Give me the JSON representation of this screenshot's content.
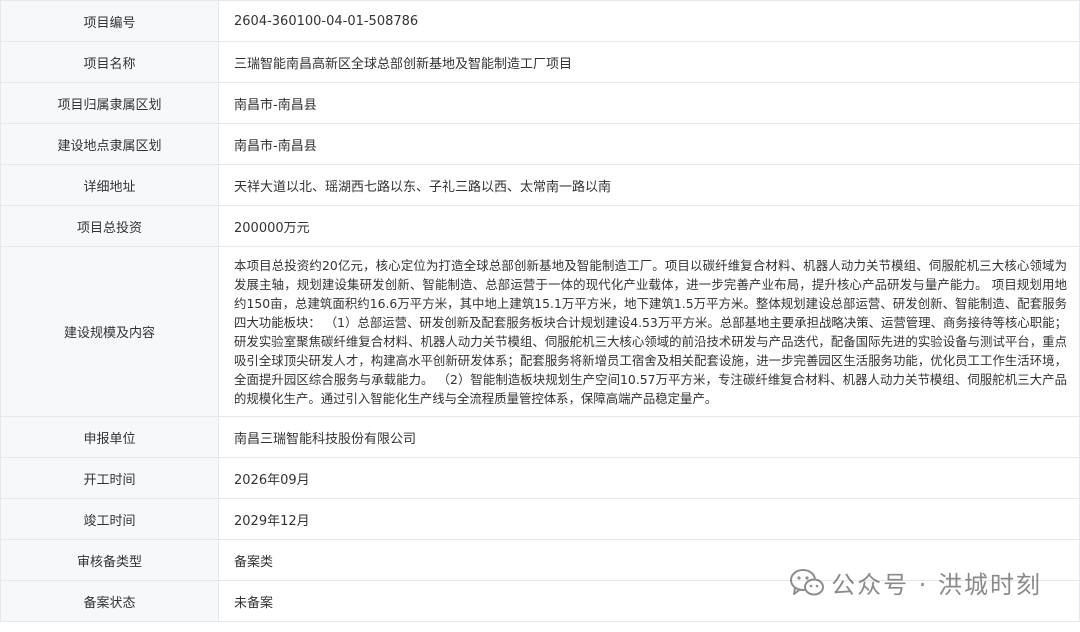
{
  "rows": [
    {
      "label": "项目编号",
      "value": "2604-360100-04-01-508786"
    },
    {
      "label": "项目名称",
      "value": "三瑞智能南昌高新区全球总部创新基地及智能制造工厂项目"
    },
    {
      "label": "项目归属隶属区划",
      "value": "南昌市-南昌县"
    },
    {
      "label": "建设地点隶属区划",
      "value": "南昌市-南昌县"
    },
    {
      "label": "详细地址",
      "value": "天祥大道以北、瑶湖西七路以东、子礼三路以西、太常南一路以南"
    },
    {
      "label": "项目总投资",
      "value": "200000万元"
    },
    {
      "label": "建设规模及内容",
      "value": "本项目总投资约20亿元，核心定位为打造全球总部创新基地及智能制造工厂。项目以碳纤维复合材料、机器人动力关节模组、伺服舵机三大核心领域为发展主轴，规划建设集研发创新、智能制造、总部运营于一体的现代化产业载体，进一步完善产业布局，提升核心产品研发与量产能力。 项目规划用地约150亩，总建筑面积约16.6万平方米，其中地上建筑15.1万平方米，地下建筑1.5万平方米。整体规划建设总部运营、研发创新、智能制造、配套服务四大功能板块： （1）总部运营、研发创新及配套服务板块合计规划建设4.53万平方米。总部基地主要承担战略决策、运营管理、商务接待等核心职能；研发实验室聚焦碳纤维复合材料、机器人动力关节模组、伺服舵机三大核心领域的前沿技术研发与产品迭代，配备国际先进的实验设备与测试平台，重点吸引全球顶尖研发人才，构建高水平创新研发体系；配套服务将新增员工宿舍及相关配套设施，进一步完善园区生活服务功能，优化员工工作生活环境，全面提升园区综合服务与承载能力。 （2）智能制造板块规划生产空间10.57万平方米，专注碳纤维复合材料、机器人动力关节模组、伺服舵机三大产品的规模化生产。通过引入智能化生产线与全流程质量管控体系，保障高端产品稳定量产。"
    },
    {
      "label": "申报单位",
      "value": "南昌三瑞智能科技股份有限公司"
    },
    {
      "label": "开工时间",
      "value": "2026年09月"
    },
    {
      "label": "竣工时间",
      "value": "2029年12月"
    },
    {
      "label": "审核备类型",
      "value": "备案类"
    },
    {
      "label": "备案状态",
      "value": "未备案"
    }
  ],
  "watermark": {
    "text": "公众号 · 洪城时刻",
    "icon": "wechat-icon"
  }
}
